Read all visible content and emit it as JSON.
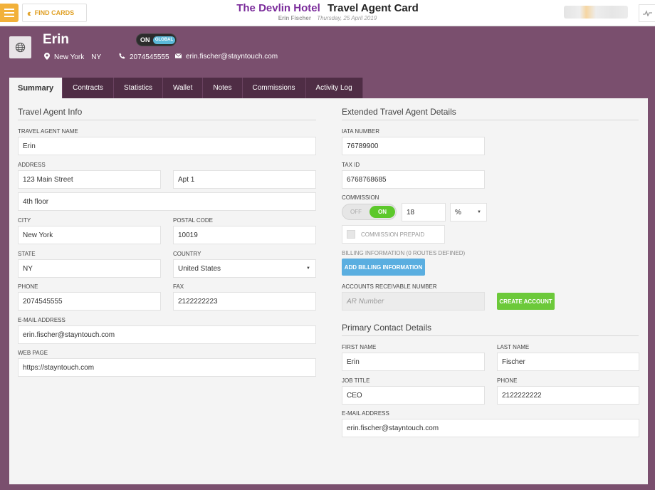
{
  "topbar": {
    "find_cards": "FIND CARDS",
    "hotel_name": "The Devlin Hotel",
    "card_title": "Travel Agent Card",
    "user": "Erin Fischer",
    "date": "Thursday, 25 April 2019",
    "brand_color": "#7b2c9b",
    "accent_color": "#f2b13a"
  },
  "header": {
    "name": "Erin",
    "toggle_on": "ON",
    "toggle_global": "GLOBAL",
    "city": "New York",
    "state": "NY",
    "phone": "2074545555",
    "email": "erin.fischer@stayntouch.com",
    "background_color": "#7a4f6e"
  },
  "tabs": [
    "Summary",
    "Contracts",
    "Statistics",
    "Wallet",
    "Notes",
    "Commissions",
    "Activity Log"
  ],
  "travel_agent_info": {
    "title": "Travel Agent Info",
    "name_label": "TRAVEL AGENT NAME",
    "name_value": "Erin",
    "address_label": "ADDRESS",
    "address_line1": "123 Main Street",
    "address_line2": "Apt 1",
    "address_line3": "4th floor",
    "city_label": "CITY",
    "city_value": "New York",
    "postal_label": "POSTAL CODE",
    "postal_value": "10019",
    "state_label": "STATE",
    "state_value": "NY",
    "country_label": "COUNTRY",
    "country_value": "United States",
    "phone_label": "PHONE",
    "phone_value": "2074545555",
    "fax_label": "FAX",
    "fax_value": "2122222223",
    "email_label": "E-MAIL ADDRESS",
    "email_value": "erin.fischer@stayntouch.com",
    "web_label": "WEB PAGE",
    "web_value": "https://stayntouch.com"
  },
  "extended_details": {
    "title": "Extended Travel Agent Details",
    "iata_label": "IATA NUMBER",
    "iata_value": "76789900",
    "tax_label": "TAX ID",
    "tax_value": "6768768685",
    "commission_label": "COMMISSION",
    "commission_off": "OFF",
    "commission_on": "ON",
    "commission_value": "18",
    "commission_unit": "%",
    "commission_prepaid": "COMMISSION PREPAID",
    "billing_label": "BILLING INFORMATION (0 ROUTES DEFINED)",
    "add_billing": "ADD BILLING INFORMATION",
    "ar_label": "ACCOUNTS RECEIVABLE NUMBER",
    "ar_placeholder": "AR Number",
    "create_account": "CREATE ACCOUNT"
  },
  "primary_contact": {
    "title": "Primary Contact Details",
    "first_name_label": "FIRST NAME",
    "first_name_value": "Erin",
    "last_name_label": "LAST NAME",
    "last_name_value": "Fischer",
    "job_label": "JOB TITLE",
    "job_value": "CEO",
    "phone_label": "PHONE",
    "phone_value": "2122222222",
    "email_label": "E-MAIL ADDRESS",
    "email_value": "erin.fischer@stayntouch.com"
  }
}
